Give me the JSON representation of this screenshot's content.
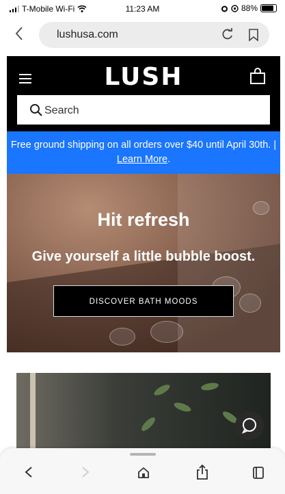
{
  "status_bar": {
    "carrier": "T-Mobile Wi-Fi",
    "time": "11:23 AM",
    "battery": "88%"
  },
  "browser": {
    "url": "lushusa.com"
  },
  "site": {
    "logo": "LUSH",
    "search_placeholder": "Search"
  },
  "banner": {
    "text": "Free ground shipping on all orders over $40 until April 30th. |",
    "link": "Learn More",
    "suffix": "."
  },
  "hero": {
    "title": "Hit refresh",
    "subtitle": "Give yourself a little bubble boost.",
    "button": "DISCOVER BATH MOODS"
  },
  "colors": {
    "banner_blue": "#1a75ff",
    "header_black": "#000000"
  },
  "icons": [
    "signal-icon",
    "wifi-icon",
    "alarm-icon",
    "battery-icon",
    "back-chevron-icon",
    "reload-icon",
    "bookmark-icon",
    "menu-icon",
    "bag-icon",
    "search-icon",
    "chat-icon",
    "back-icon",
    "forward-icon",
    "home-icon",
    "share-icon",
    "tabs-icon"
  ]
}
